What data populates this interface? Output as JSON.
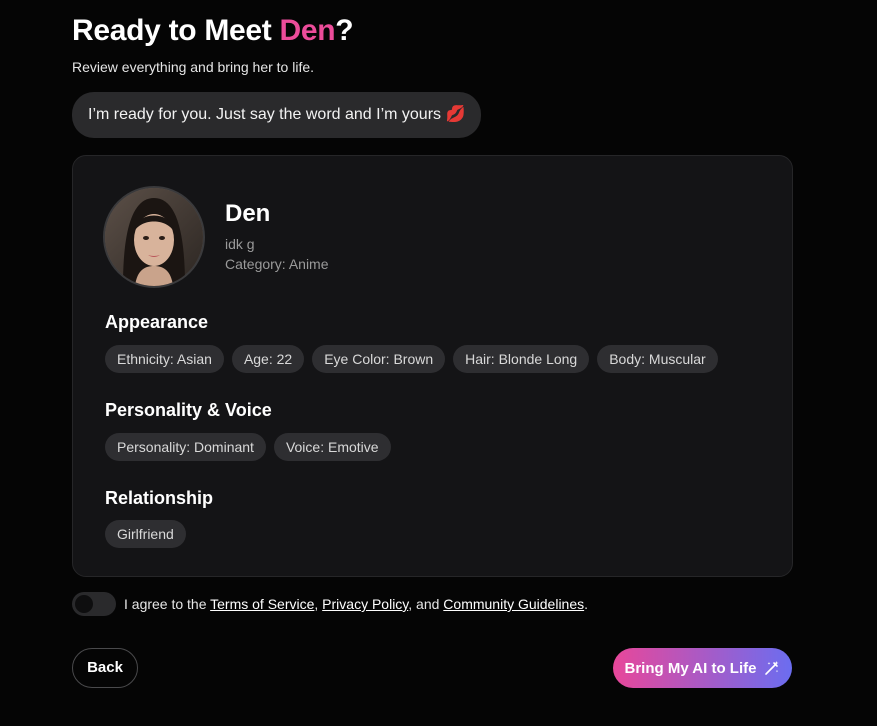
{
  "header": {
    "title_prefix": "Ready to Meet ",
    "title_name": "Den",
    "title_suffix": "?",
    "subtitle": "Review everything and bring her to life."
  },
  "message": {
    "text": "I’m ready for you. Just say the word and I’m yours",
    "emoji": "💋"
  },
  "profile": {
    "name": "Den",
    "description": "idk g",
    "category": "Category: Anime"
  },
  "sections": {
    "appearance": {
      "title": "Appearance",
      "tags": [
        "Ethnicity: Asian",
        "Age: 22",
        "Eye Color: Brown",
        "Hair: Blonde Long",
        "Body: Muscular"
      ]
    },
    "personality": {
      "title": "Personality & Voice",
      "tags": [
        "Personality: Dominant",
        "Voice: Emotive"
      ]
    },
    "relationship": {
      "title": "Relationship",
      "tags": [
        "Girlfriend"
      ]
    }
  },
  "agreement": {
    "prefix": "I agree to the ",
    "terms": "Terms of Service",
    "sep1": ", ",
    "privacy": "Privacy Policy",
    "sep2": ", and ",
    "guidelines": "Community Guidelines",
    "suffix": "."
  },
  "buttons": {
    "back": "Back",
    "cta": "Bring My AI to Life",
    "cta_icon": "magic-wand-icon"
  },
  "colors": {
    "accent_pink": "#ec4c9a",
    "gradient_end": "#6b6df0"
  }
}
